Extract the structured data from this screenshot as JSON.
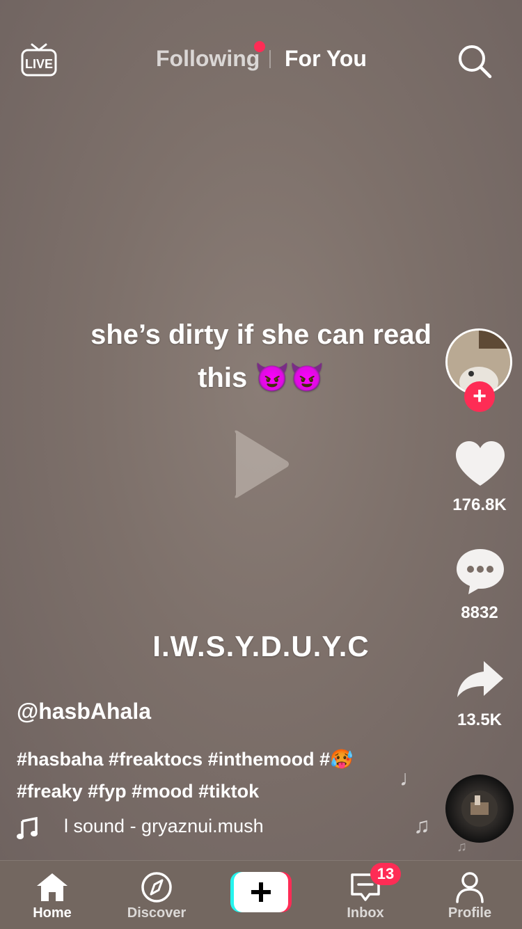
{
  "header": {
    "live_label": "LIVE",
    "tabs": [
      {
        "label": "Following",
        "has_dot": true
      },
      {
        "label": "For You",
        "active": true
      }
    ]
  },
  "video": {
    "caption_lines": [
      "she’s dirty if she can read",
      "this 😈😈"
    ],
    "overlay_code": "I.W.S.Y.D.U.Y.C"
  },
  "rail": {
    "likes": "176.8K",
    "comments": "8832",
    "shares": "13.5K"
  },
  "post": {
    "username": "@hasbAhala",
    "description_line1": "#hasbaha #freaktocs #inthemood #🥵",
    "description_line2": "#freaky #fyp #mood #tiktok",
    "sound_separator": "l",
    "sound": "l sound - gryaznui.mush"
  },
  "nav": {
    "items": [
      {
        "label": "Home",
        "active": true
      },
      {
        "label": "Discover"
      },
      {
        "label": "Inbox",
        "badge": "13"
      },
      {
        "label": "Profile"
      }
    ]
  },
  "colors": {
    "accent": "#fe2c55",
    "cyan": "#25f4ee"
  }
}
